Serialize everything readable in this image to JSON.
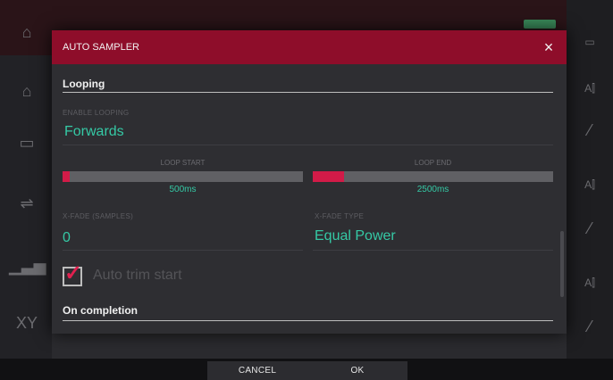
{
  "dialog": {
    "title": "AUTO SAMPLER",
    "close_icon": "×",
    "looping": {
      "section_title": "Looping",
      "enable_looping_label": "ENABLE LOOPING",
      "enable_looping_value": "Forwards",
      "loop_start_label": "LOOP START",
      "loop_start_value": "500ms",
      "loop_start_level": 0.03,
      "loop_end_label": "LOOP END",
      "loop_end_value": "2500ms",
      "loop_end_level": 0.13,
      "xfade_samples_label": "X-FADE (SAMPLES)",
      "xfade_samples_value": "0",
      "xfade_type_label": "X-FADE TYPE",
      "xfade_type_value": "Equal Power",
      "auto_trim_label": "Auto trim start",
      "auto_trim_checked": true
    },
    "completion": {
      "section_title": "On completion"
    }
  },
  "footer": {
    "cancel_label": "CANCEL",
    "ok_label": "OK"
  },
  "colors": {
    "accent": "#8e0d2a",
    "slider_fill": "#d21b48",
    "value_text": "#35c9a5"
  },
  "background_icons": [
    "home-icon",
    "grid-icon",
    "mixer-icon",
    "levels-icon",
    "xy-icon",
    "pencil-icon"
  ]
}
